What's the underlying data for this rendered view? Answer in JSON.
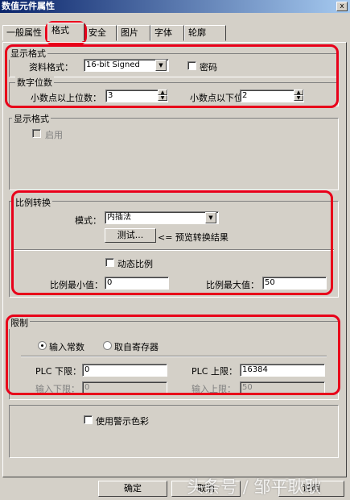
{
  "window": {
    "title": "数值元件属性",
    "close_label": "x"
  },
  "tabs": [
    {
      "label": "一般属性"
    },
    {
      "label": "格式"
    },
    {
      "label": "安全"
    },
    {
      "label": "图片"
    },
    {
      "label": "字体"
    },
    {
      "label": "轮廓"
    }
  ],
  "display_format": {
    "group_label": "显示格式",
    "data_format_label": "资料格式：",
    "data_format_value": "16-bit Signed",
    "password_label": "密码",
    "password_checked": false
  },
  "digits": {
    "group_label": "数字位数",
    "left_label": "小数点以上位数：",
    "left_value": "3",
    "right_label": "小数点以下位数：",
    "right_value": "2"
  },
  "display_style": {
    "group_label": "显示格式",
    "enable_label": "启用",
    "enable_checked": false
  },
  "scaling": {
    "group_label": "比例转换",
    "mode_label": "模式：",
    "mode_value": "内插法",
    "test_button": "测试...",
    "preview_text": "<= 预览转换结果",
    "dynamic_label": "动态比例",
    "dynamic_checked": false,
    "min_label": "比例最小值：",
    "min_value": "0",
    "max_label": "比例最大值：",
    "max_value": "50"
  },
  "limits": {
    "group_label": "限制",
    "radio_const_label": "输入常数",
    "radio_reg_label": "取自寄存器",
    "selected": "输入常数",
    "plc_low_label": "PLC 下限：",
    "plc_low_value": "0",
    "plc_high_label": "PLC 上限：",
    "plc_high_value": "16384",
    "in_low_label": "输入下限：",
    "in_low_value": "0",
    "in_high_label": "输入上限：",
    "in_high_value": "50"
  },
  "warning": {
    "use_color_label": "使用警示色彩",
    "checked": false
  },
  "footer": {
    "ok_label": "确定",
    "cancel_label": "取消",
    "help_label": "说明"
  },
  "watermark": "头条号 / 邹平耿耿"
}
